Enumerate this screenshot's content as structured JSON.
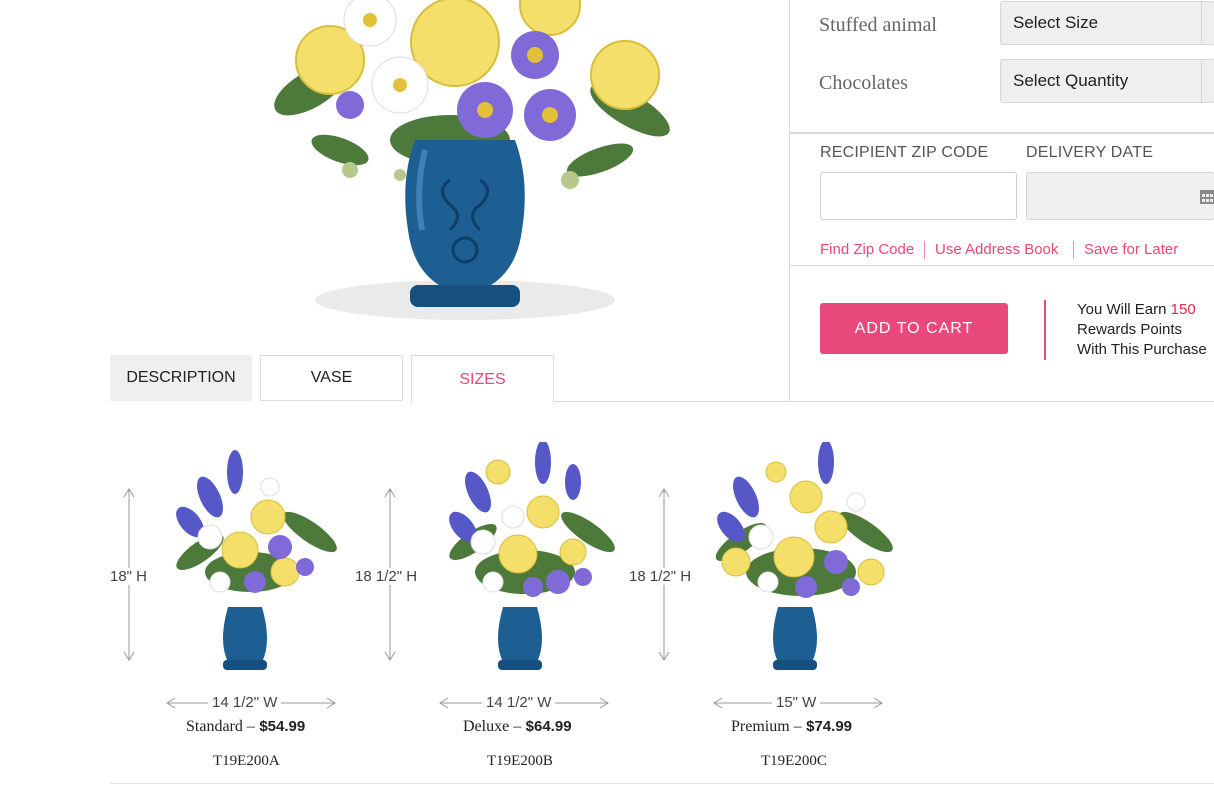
{
  "addons": [
    {
      "label": "Stuffed animal",
      "select_value": "Select Size"
    },
    {
      "label": "Chocolates",
      "select_value": "Select Quantity"
    }
  ],
  "delivery": {
    "zip_label": "RECIPIENT ZIP CODE",
    "zip_value": "",
    "date_label": "DELIVERY DATE",
    "date_value": "",
    "links": [
      "Find Zip Code",
      "Use Address Book",
      "Save for Later"
    ]
  },
  "cart": {
    "button_label": "ADD TO CART",
    "rewards_prefix": "You Will Earn",
    "rewards_points": "150",
    "rewards_line2": "Rewards Points",
    "rewards_line3": "With This Purchase"
  },
  "tabs": [
    {
      "label": "DESCRIPTION"
    },
    {
      "label": "VASE"
    },
    {
      "label": "SIZES"
    }
  ],
  "sizes": [
    {
      "height": "18\" H",
      "width": "14 1/2\" W",
      "name": "Standard –",
      "price": "$54.99",
      "sku": "T19E200A"
    },
    {
      "height": "18 1/2\" H",
      "width": "14 1/2\" W",
      "name": "Deluxe –",
      "price": "$64.99",
      "sku": "T19E200B"
    },
    {
      "height": "18 1/2\" H",
      "width": "15\" W",
      "name": "Premium –",
      "price": "$74.99",
      "sku": "T19E200C"
    }
  ],
  "colors": {
    "accent": "#e8497a",
    "vase_blue": "#1d5e93",
    "rose_yellow": "#f3df6a",
    "aster_purple": "#7f6ad8"
  }
}
